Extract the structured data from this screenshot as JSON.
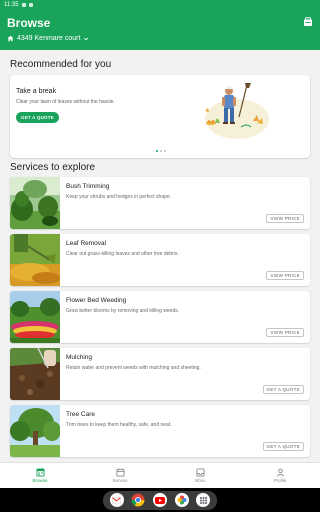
{
  "status_bar": {
    "time": "11:35"
  },
  "app_bar": {
    "title": "Browse",
    "address": "4349 Kenmare court"
  },
  "recommended": {
    "section_title": "Recommended for you",
    "card": {
      "heading": "Take a break",
      "subtitle": "Clear your lawn of leaves without the hassle.",
      "button_label": "GET A QUOTE"
    },
    "pager": {
      "count": 3,
      "active": 1
    }
  },
  "services": {
    "section_title": "Services to explore",
    "items": [
      {
        "name": "Bush Trimming",
        "description": "Keep your shrubs and hedges in perfect shape.",
        "action": "VIEW PRICE"
      },
      {
        "name": "Leaf Removal",
        "description": "Clear out grass-killing leaves and other tree debris.",
        "action": "VIEW PRICE"
      },
      {
        "name": "Flower Bed Weeding",
        "description": "Grow better blooms by removing and killing weeds.",
        "action": "VIEW PRICE"
      },
      {
        "name": "Mulching",
        "description": "Retain water and prevent weeds with mulching and sheeting.",
        "action": "GET A QUOTE"
      },
      {
        "name": "Tree Care",
        "description": "Trim trees to keep them healthy, safe, and neat.",
        "action": "GET A QUOTE"
      }
    ]
  },
  "bottom_nav": {
    "items": [
      {
        "label": "Browse",
        "icon": "browse-icon",
        "active": true
      },
      {
        "label": "Service",
        "icon": "calendar-icon",
        "active": false
      },
      {
        "label": "Inbox",
        "icon": "inbox-icon",
        "active": false
      },
      {
        "label": "Profile",
        "icon": "person-icon",
        "active": false
      }
    ]
  },
  "dock_apps": [
    "gmail-icon",
    "chrome-icon",
    "youtube-icon",
    "photos-icon",
    "apps-icon"
  ],
  "colors": {
    "brand_green": "#1aa35a"
  }
}
